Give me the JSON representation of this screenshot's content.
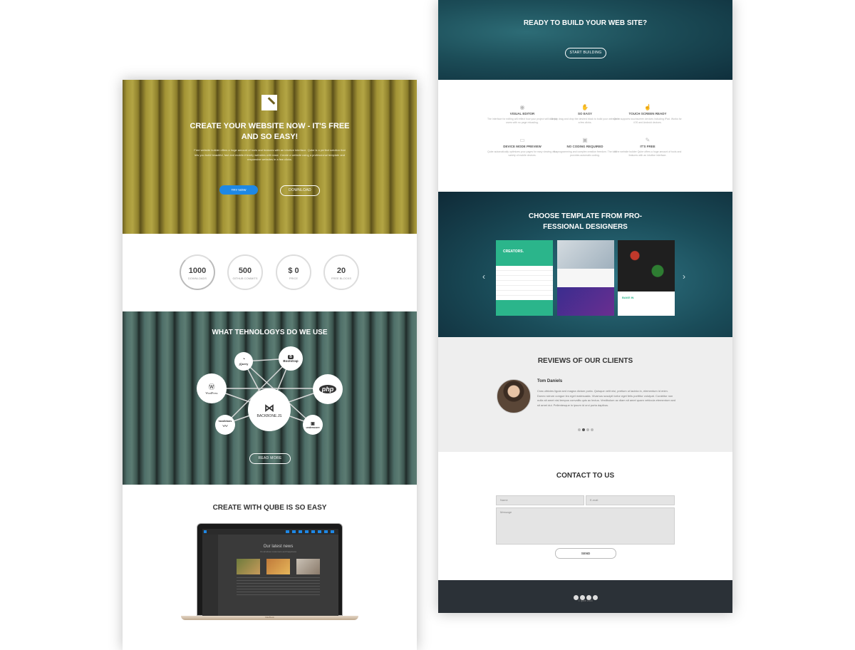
{
  "left": {
    "hero": {
      "title": "CREATE YOUR WEBSITE NOW - IT'S FREE AND SO EASY!",
      "text": "Free website builder offers a huge amount of tools and features with an intuitive interface. Qube is a perfect solution that lets you build beautiful, fast and mobile-friendly websites with ease. Create a website using a professional template and responsive websites in a few clicks.",
      "try_label": "TRY NOW",
      "download_label": "DOWNLOAD"
    },
    "stats": [
      {
        "value": "1000",
        "label": "DOWNLOADS"
      },
      {
        "value": "500",
        "label": "GITHUB COMMITS"
      },
      {
        "value": "$ 0",
        "label": "PRICE"
      },
      {
        "value": "20",
        "label": "FREE BLOCKS"
      }
    ],
    "tech": {
      "title": "WHAT TEHNOLOGYS DO WE USE",
      "center": "BACKBONE.JS",
      "items": {
        "jquery": "jQuery",
        "bootstrap": "Bootstrap",
        "wordpress": "WordPress",
        "php": "php",
        "handlebars": "handlebars",
        "underscore": "underscore"
      },
      "more_label": "READ MORE"
    },
    "easy": {
      "title": "CREATE WITH QUBE IS SO EASY",
      "screen_title": "Our latest news",
      "screen_sub": "It's all about customers and happiness",
      "device_label": "MacBook"
    }
  },
  "right": {
    "cta": {
      "title": "READY TO BUILD YOUR WEB SITE?",
      "button": "START BUILDING"
    },
    "features": [
      {
        "icon": "eye-icon",
        "glyph": "◉",
        "title": "VISUAL EDITOR",
        "text": "The interface for editing will reflect how your project will look for users with no page reloading."
      },
      {
        "icon": "hand-icon",
        "glyph": "✋",
        "title": "SO EASY",
        "text": "Simply drag and drop the desired block to build your website in a few clicks."
      },
      {
        "icon": "touch-icon",
        "glyph": "☝",
        "title": "TOUCH SCREEN READY",
        "text": "Qube supports touchscreen devices including iPad. Works for iOS and Android devices."
      },
      {
        "icon": "tablet-icon",
        "glyph": "▭",
        "title": "DEVICE MODE PREVIEW",
        "text": "Qube automatically optimizes your pages for easy viewing on a variety of mobile devices."
      },
      {
        "icon": "code-icon",
        "glyph": "▣",
        "title": "NO CODING REQUIRED",
        "text": "No programming and complex creation freedom. The tool provides automatic coding."
      },
      {
        "icon": "free-icon",
        "glyph": "✎",
        "title": "IT'S FREE",
        "text": "If the website builder Qube offers a huge amount of tools and features with an intuitive interface."
      }
    ],
    "templates": {
      "title": "CHOOSE TEMPLATE FROM PRO-FESSIONAL DESIGNERS",
      "t1": "CREATORS.",
      "t3": "BAKE IN"
    },
    "reviews": {
      "title": "REVIEWS OF OUR CLIENTS",
      "name": "Tom Daniels",
      "text": "Cras ultricies ligula sed magna dictum porta. Quisque velit nisi, pretium ut lacinia in, elementum id enim. Donec rutrum congue leo eget malesuada. Vivamus suscipit tortor eget felis porttitor volutpat. Curabitur non nulla sit amet nisl tempus convallis quis ac lectus. Vestibulum ac diam sit amet quam vehicula elementum sed sit amet dui. Pellentesque in ipsum id orci porta dapibus."
    },
    "contact": {
      "title": "CONTACT TO US",
      "name_ph": "Name",
      "email_ph": "E-mail",
      "message_ph": "Message",
      "send": "SEND"
    },
    "footer": {
      "copyright": "© qube 2016"
    }
  },
  "colors": {
    "accent_blue": "#1e88e5",
    "footer": "#2b3137",
    "reviews_bg": "#eeeeee"
  }
}
